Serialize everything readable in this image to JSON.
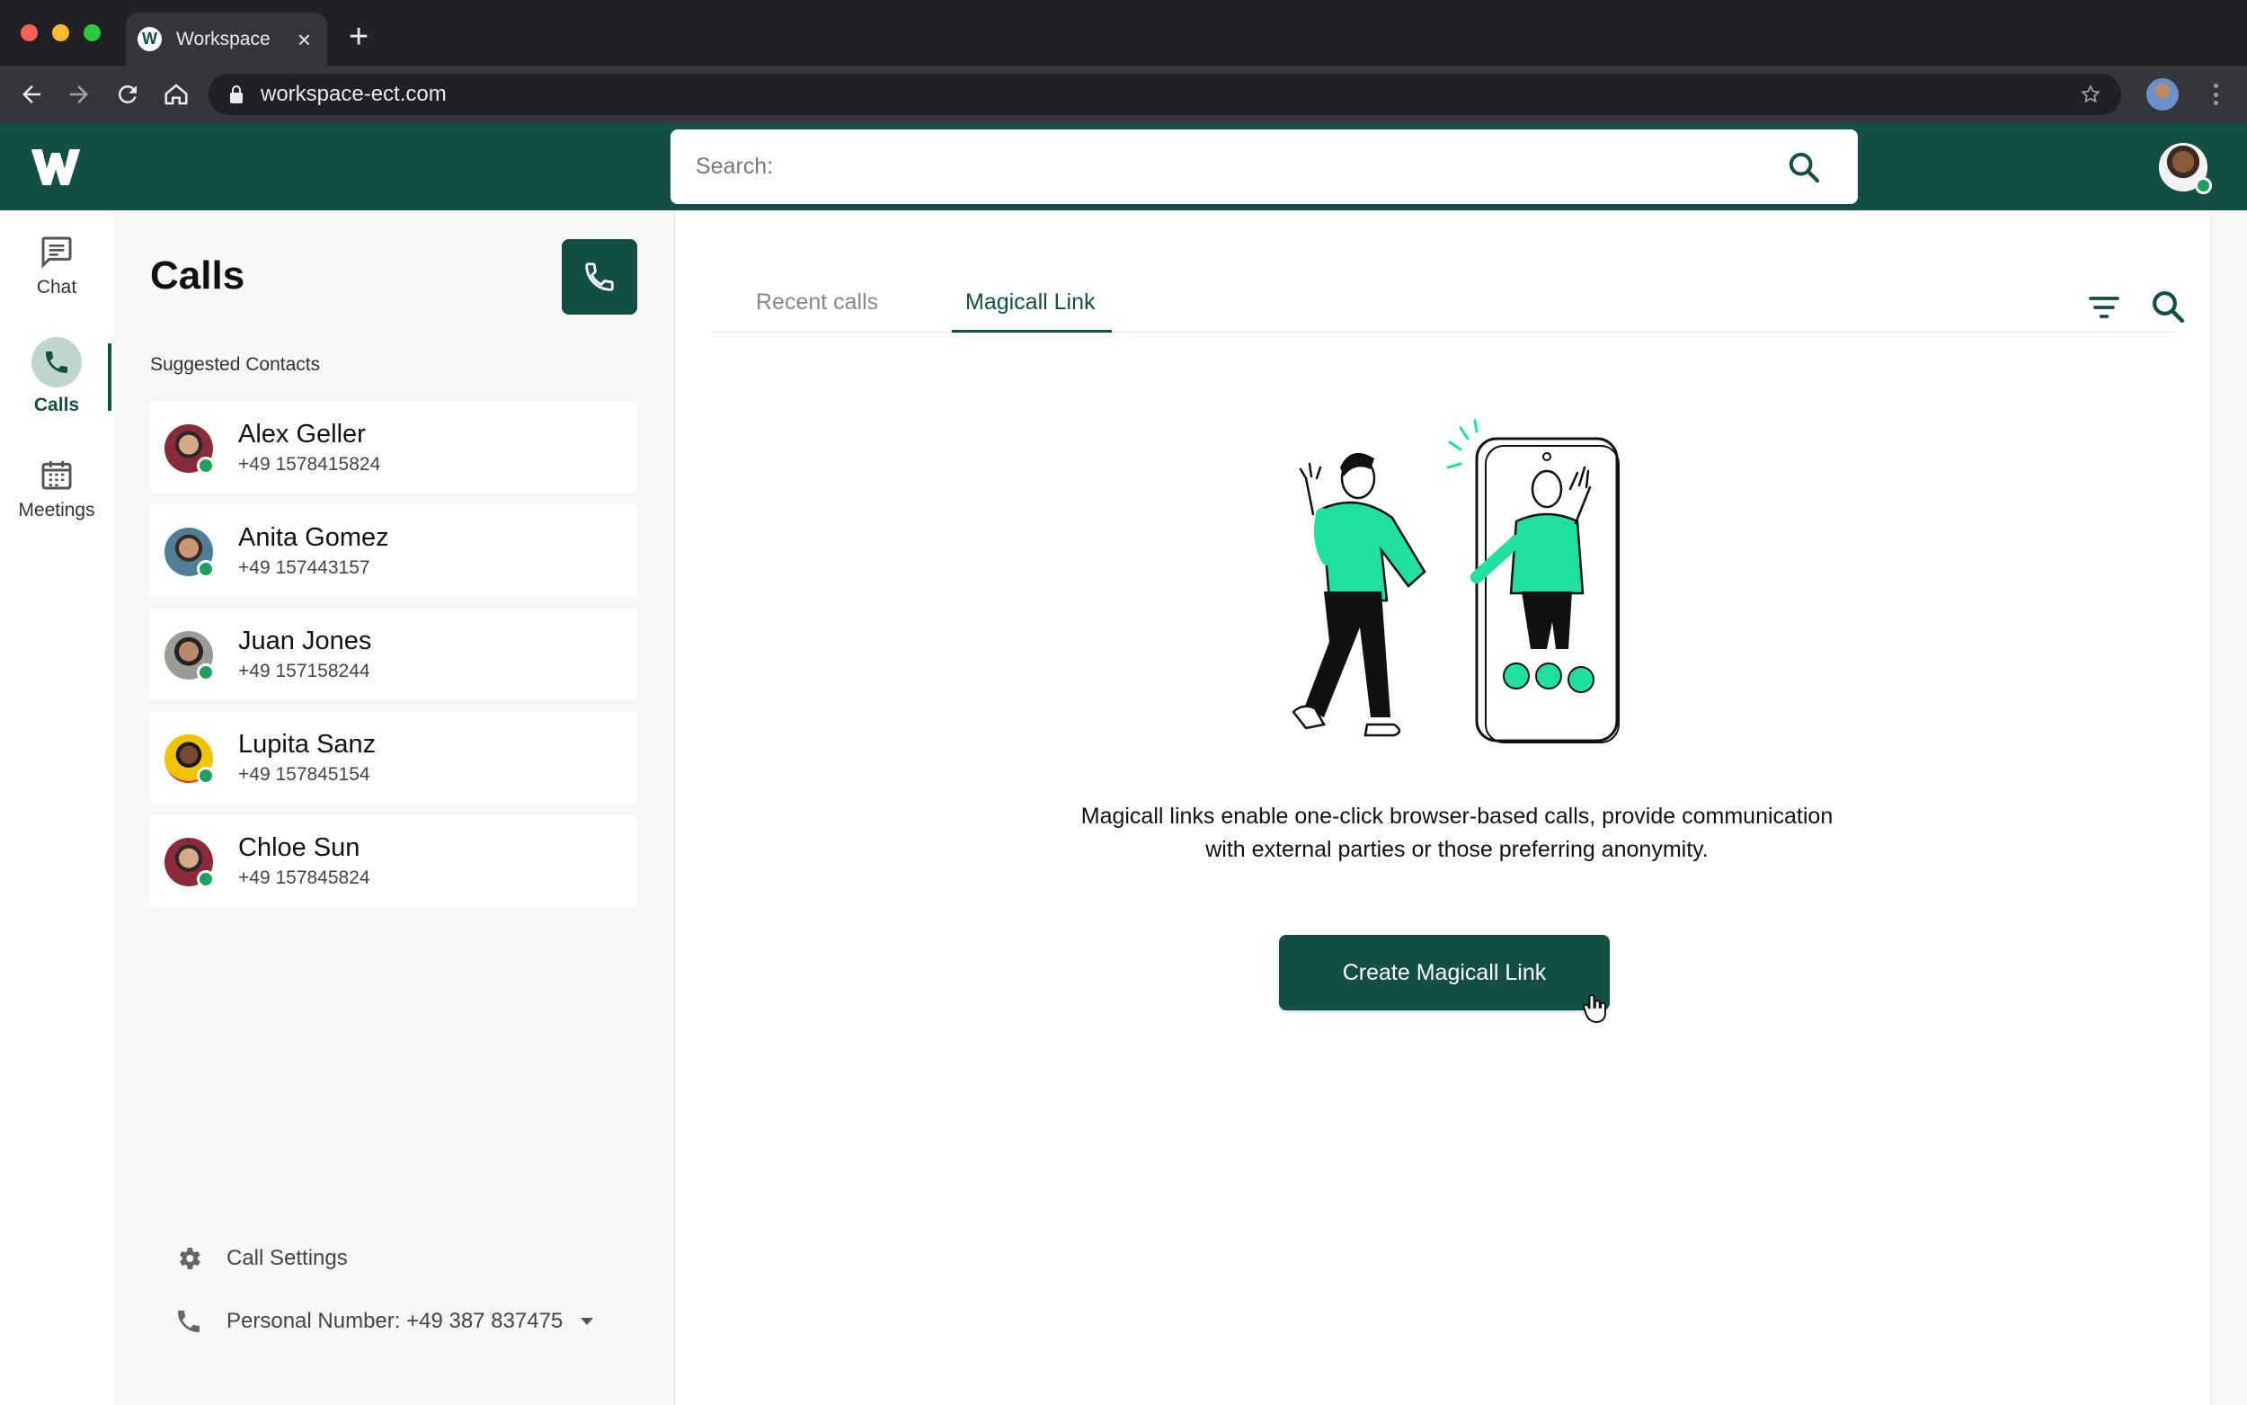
{
  "browser": {
    "tab_title": "Workspace",
    "favicon_letter": "W",
    "url": "workspace-ect.com"
  },
  "header": {
    "search_placeholder": "Search:"
  },
  "rail": {
    "items": [
      {
        "label": "Chat",
        "icon": "chat-icon"
      },
      {
        "label": "Calls",
        "icon": "phone-icon",
        "active": true
      },
      {
        "label": "Meetings",
        "icon": "calendar-icon"
      }
    ]
  },
  "calls_panel": {
    "title": "Calls",
    "section_label": "Suggested Contacts",
    "contacts": [
      {
        "name": "Alex Geller",
        "phone": "+49 1578415824",
        "status": "online"
      },
      {
        "name": "Anita Gomez",
        "phone": "+49 157443157",
        "status": "online"
      },
      {
        "name": "Juan Jones",
        "phone": "+49 157158244",
        "status": "online"
      },
      {
        "name": "Lupita Sanz",
        "phone": "+49 157845154",
        "status": "online"
      },
      {
        "name": "Chloe Sun",
        "phone": "+49 157845824",
        "status": "online"
      }
    ],
    "call_settings_label": "Call Settings",
    "personal_number_label": "Personal Number: +49 387 837475"
  },
  "main": {
    "tabs": [
      {
        "label": "Recent calls",
        "active": false
      },
      {
        "label": "Magicall Link",
        "active": true
      }
    ],
    "description_line1": "Magicall links enable one-click browser-based calls, provide communication",
    "description_line2": "with external parties or those preferring anonymity.",
    "cta_label": "Create Magicall Link"
  },
  "colors": {
    "brand": "#134f44",
    "accent": "#1fe0a0",
    "online": "#1fa05c"
  }
}
